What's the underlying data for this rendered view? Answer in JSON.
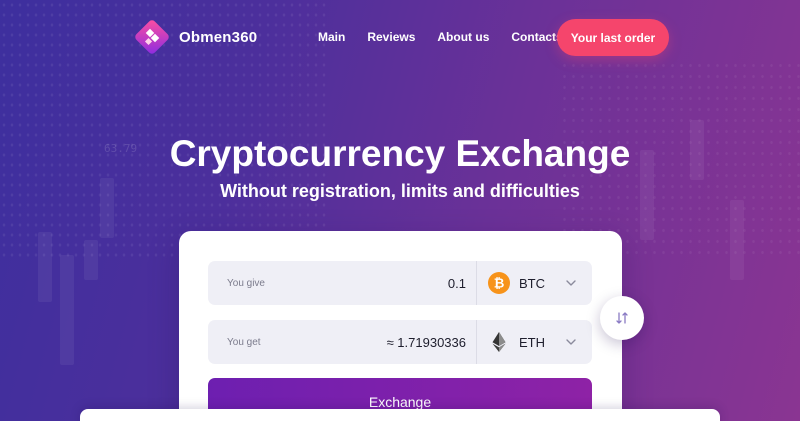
{
  "brand": {
    "name": "Obmen360",
    "logo_icon": "obmen360-logo-icon",
    "accent": "#f5456c",
    "primary_gradient": [
      "#6d1fb0",
      "#8e22a6"
    ]
  },
  "nav": {
    "items": [
      {
        "label": "Main"
      },
      {
        "label": "Reviews"
      },
      {
        "label": "About us"
      },
      {
        "label": "Contacts"
      }
    ],
    "order_button": "Your last order"
  },
  "hero": {
    "title": "Cryptocurrency Exchange",
    "subtitle": "Without registration, limits and difficulties"
  },
  "exchange": {
    "give": {
      "label": "You give",
      "value": "0.1",
      "currency": "BTC",
      "currency_icon": "bitcoin-icon"
    },
    "get": {
      "label": "You get",
      "value": "≈ 1.71930336",
      "currency": "ETH",
      "currency_icon": "ethereum-icon"
    },
    "swap_icon": "swap-arrows-icon",
    "submit": "Exchange"
  },
  "background_ghost_text": "63.79"
}
